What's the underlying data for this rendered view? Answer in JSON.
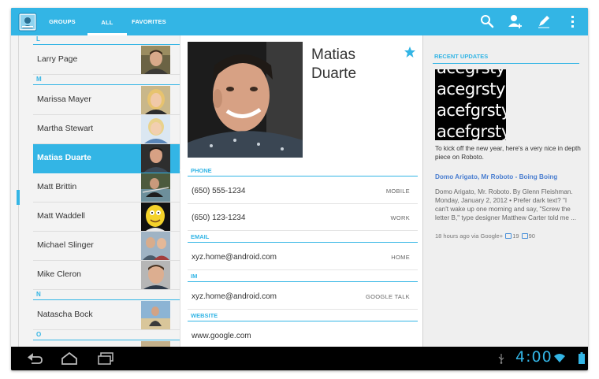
{
  "action_bar": {
    "tabs": [
      {
        "label": "GROUPS"
      },
      {
        "label": "ALL"
      },
      {
        "label": "FAVORITES"
      }
    ],
    "icons": [
      "people-app-icon",
      "search-icon",
      "add-contact-icon",
      "edit-icon",
      "overflow-menu-icon"
    ],
    "accent_color": "#33b5e5"
  },
  "contact_list": {
    "sections": {
      "L": "L",
      "M": "M",
      "N": "N",
      "O": "O"
    },
    "contacts": [
      {
        "name": "Larry Page"
      },
      {
        "name": "Marissa Mayer"
      },
      {
        "name": "Martha Stewart"
      },
      {
        "name": "Matias Duarte"
      },
      {
        "name": "Matt Brittin"
      },
      {
        "name": "Matt Waddell"
      },
      {
        "name": "Michael Slinger"
      },
      {
        "name": "Mike Cleron"
      },
      {
        "name": "Natascha Bock"
      }
    ],
    "selected": "Matias Duarte"
  },
  "detail": {
    "name": "Matias Duarte",
    "starred": true,
    "sections": {
      "phone": "PHONE",
      "email": "EMAIL",
      "im": "IM",
      "website": "WEBSITE"
    },
    "phones": [
      {
        "value": "(650) 555-1234",
        "type": "MOBILE"
      },
      {
        "value": "(650) 123-1234",
        "type": "WORK"
      }
    ],
    "email": {
      "value": "xyz.home@android.com",
      "type": "HOME"
    },
    "im": {
      "value": "xyz.home@android.com",
      "type": "GOOGLE TALK"
    },
    "website": {
      "value": "www.google.com"
    }
  },
  "updates": {
    "header": "RECENT UPDATES",
    "image_lines": [
      "acegrsty",
      "acegrsty",
      "acefgrsty",
      "acefgrsty"
    ],
    "caption": "To kick off the new year, here's a very nice in depth piece on Roboto.",
    "link_title": "Domo Arigato, Mr Roboto - Boing Boing",
    "snippet": "Domo Arigato, Mr. Roboto. By Glenn Fleishman. Monday, January 2, 2012 • Prefer dark text? \"I can't wake up one morning and say, \"Screw the letter B,\" type designer Matthew Carter told me ...",
    "meta": "18 hours ago via Google+",
    "comments": "19",
    "plus_ones": "90"
  },
  "status_bar": {
    "time": "4:00"
  }
}
